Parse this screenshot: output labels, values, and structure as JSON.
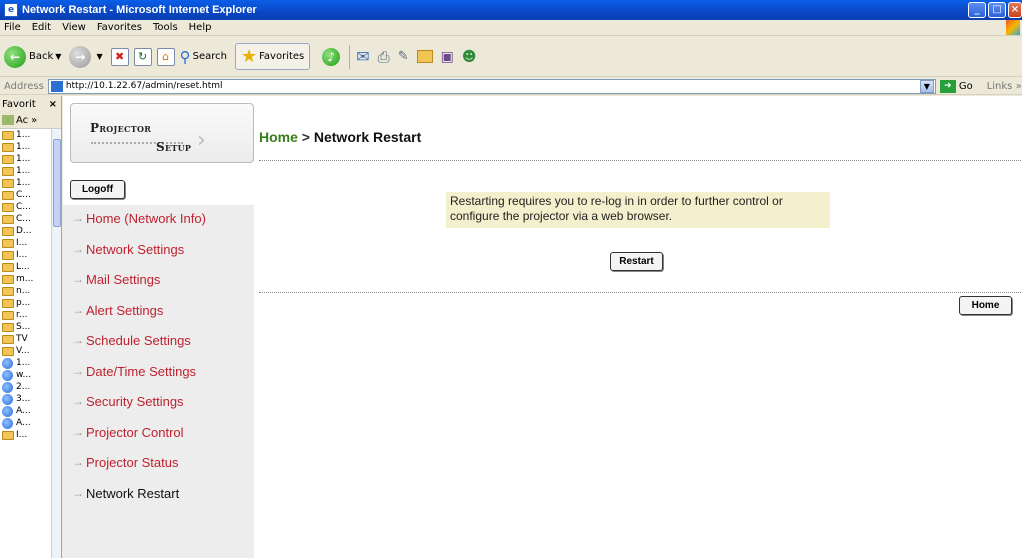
{
  "window": {
    "title": "Network Restart - Microsoft Internet Explorer",
    "controls": {
      "minimize": "_",
      "maximize": "□",
      "close": "×"
    }
  },
  "menu": [
    "File",
    "Edit",
    "View",
    "Favorites",
    "Tools",
    "Help"
  ],
  "toolbar": {
    "back": "Back",
    "search": "Search",
    "favorites": "Favorites"
  },
  "address": {
    "label": "Address",
    "url": "http://10.1.22.67/admin/reset.html",
    "go": "Go",
    "links": "Links"
  },
  "favorites_pane": {
    "title": "Favorit",
    "add": "Ac",
    "items": [
      {
        "icon": "folder",
        "label": "1..."
      },
      {
        "icon": "folder",
        "label": "1..."
      },
      {
        "icon": "folder",
        "label": "1..."
      },
      {
        "icon": "folder",
        "label": "1..."
      },
      {
        "icon": "folder",
        "label": "1..."
      },
      {
        "icon": "folder",
        "label": "C..."
      },
      {
        "icon": "folder",
        "label": "C..."
      },
      {
        "icon": "folder",
        "label": "C..."
      },
      {
        "icon": "folder",
        "label": "D..."
      },
      {
        "icon": "folder",
        "label": "I..."
      },
      {
        "icon": "folder",
        "label": "I..."
      },
      {
        "icon": "folder",
        "label": "L..."
      },
      {
        "icon": "folder",
        "label": "m..."
      },
      {
        "icon": "folder",
        "label": "n..."
      },
      {
        "icon": "folder",
        "label": "p..."
      },
      {
        "icon": "folder",
        "label": "r..."
      },
      {
        "icon": "folder",
        "label": "S..."
      },
      {
        "icon": "folder",
        "label": "TV"
      },
      {
        "icon": "folder",
        "label": "V..."
      },
      {
        "icon": "ie",
        "label": "1..."
      },
      {
        "icon": "ie",
        "label": "w..."
      },
      {
        "icon": "ie",
        "label": "2..."
      },
      {
        "icon": "ie",
        "label": "3..."
      },
      {
        "icon": "ie",
        "label": "A..."
      },
      {
        "icon": "ie",
        "label": "A..."
      },
      {
        "icon": "folder",
        "label": "I..."
      }
    ]
  },
  "logo": {
    "line1": "Projector",
    "line2": "Setup"
  },
  "logoff_label": "Logoff",
  "nav": [
    "Home (Network Info)",
    "Network Settings",
    "Mail Settings",
    "Alert Settings",
    "Schedule Settings",
    "Date/Time Settings",
    "Security Settings",
    "Projector Control",
    "Projector Status",
    "Network Restart"
  ],
  "nav_current_index": 9,
  "breadcrumb": {
    "home": "Home",
    "sep": ">",
    "current": "Network Restart"
  },
  "notice": "Restarting requires you to re-log in in order to further control or configure the projector via a web browser.",
  "restart_label": "Restart",
  "home_label": "Home",
  "colors": {
    "nav_link": "#c0212e",
    "breadcrumb_home": "#3a7d1a",
    "notice_bg": "#f4efcc",
    "nav_bg": "#ededed"
  }
}
